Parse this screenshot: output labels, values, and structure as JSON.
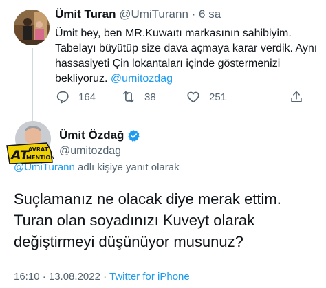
{
  "reply": {
    "name": "Ümit Turan",
    "handle": "@UmiTurann",
    "time": "· 6 sa",
    "body": "Ümit bey, ben MR.Kuwaıtı markasının sahibiyim. Tabelayı büyütüp size dava açmaya karar verdik. Aynı hassasiyeti Çin lokantaları içinde göstermenizi bekliyoruz. ",
    "mention": "@umitozdag",
    "actions": {
      "reply_count": "164",
      "retweet_count": "38",
      "like_count": "251"
    }
  },
  "main": {
    "name": "Ümit Özdağ",
    "handle": "@umitozdag",
    "watermark": "AT AVRAT MENTION",
    "reply_to_handle": "@UmiTurann",
    "reply_to_text": " adlı kişiye yanıt olarak",
    "text": "Suçlamanız ne olacak diye merak ettim. Turan olan soyadınızı Kuveyt olarak değiştirmeyi düşünüyor musunuz?",
    "timestamp": "16:10 · 13.08.2022 · ",
    "source": "Twitter for iPhone"
  },
  "colors": {
    "accent": "#1d9bf0",
    "secondary_text": "#536471",
    "verified": "#1d9bf0"
  },
  "icons": [
    "reply-icon",
    "retweet-icon",
    "like-icon",
    "share-icon",
    "verified-badge-icon"
  ]
}
